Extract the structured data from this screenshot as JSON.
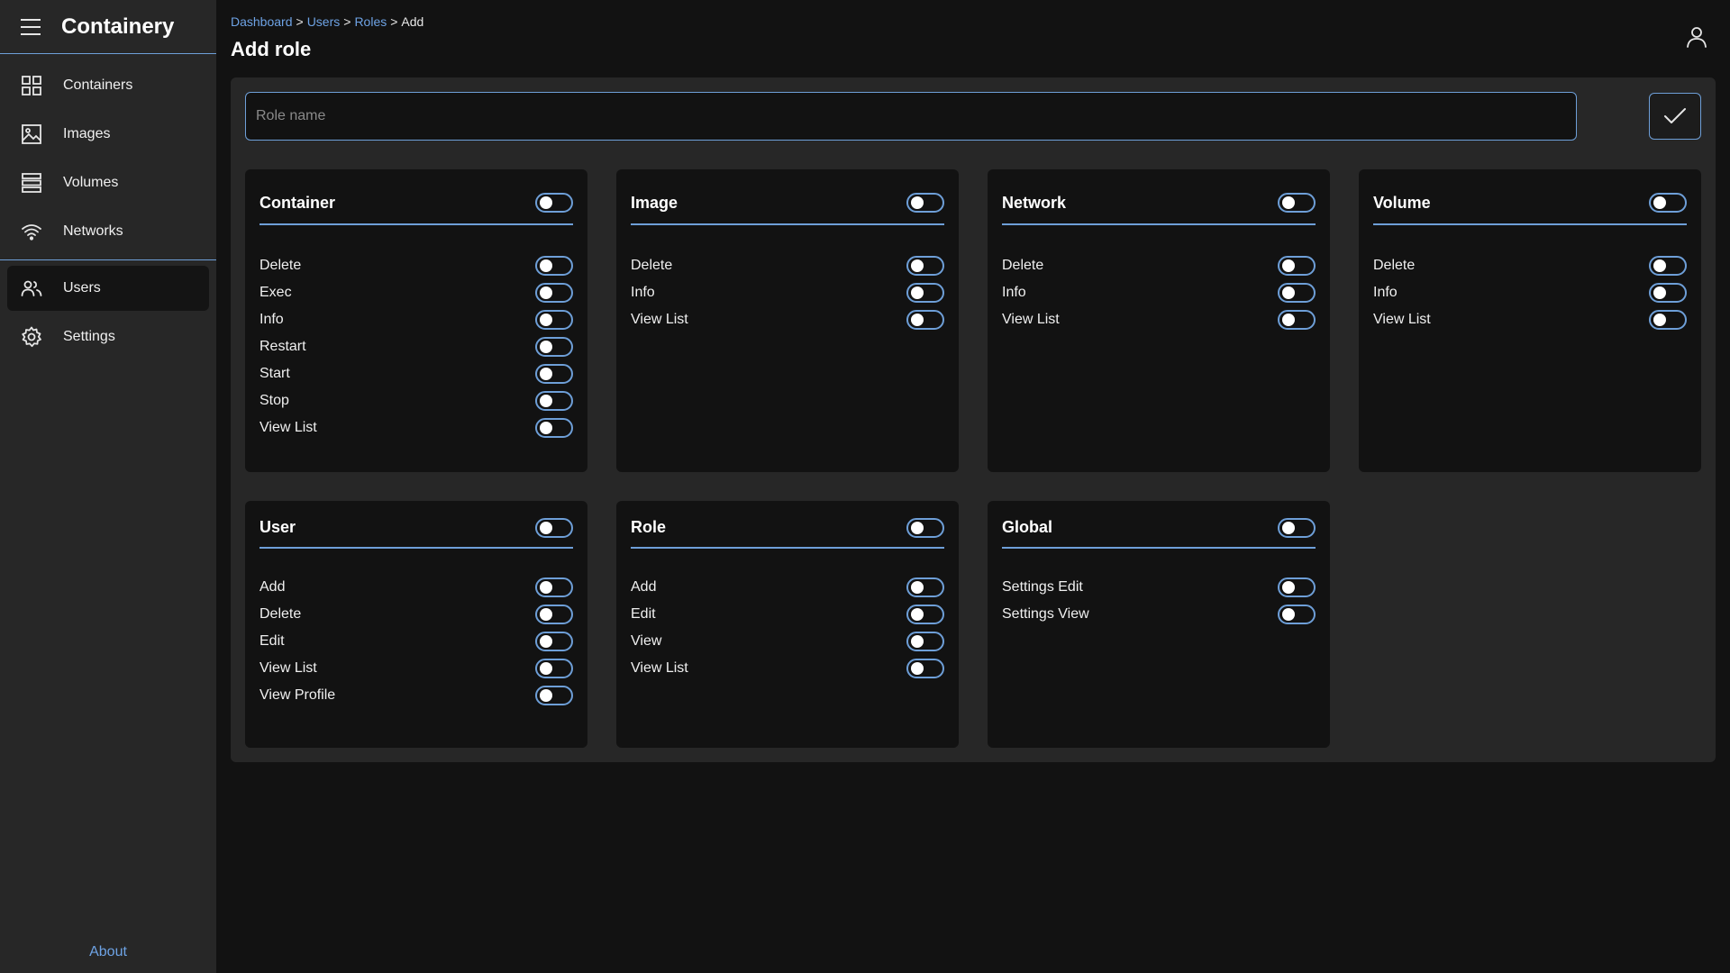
{
  "app": {
    "title": "Containery"
  },
  "sidebar": {
    "items": [
      {
        "label": "Containers",
        "icon": "grid-icon"
      },
      {
        "label": "Images",
        "icon": "image-icon"
      },
      {
        "label": "Volumes",
        "icon": "storage-icon"
      },
      {
        "label": "Networks",
        "icon": "wifi-icon"
      }
    ],
    "secondary": [
      {
        "label": "Users",
        "icon": "users-icon",
        "active": true
      },
      {
        "label": "Settings",
        "icon": "gear-icon"
      }
    ],
    "about": "About"
  },
  "breadcrumb": {
    "links": [
      "Dashboard",
      "Users",
      "Roles"
    ],
    "separator": ">",
    "current": "Add"
  },
  "page": {
    "title": "Add role"
  },
  "form": {
    "role_name_placeholder": "Role name",
    "role_name_value": ""
  },
  "colors": {
    "accent": "#6e9fd8",
    "link": "#6ea3e5",
    "sidebar_bg": "#272727",
    "page_bg": "#121212"
  },
  "cards": [
    {
      "title": "Container",
      "permissions": [
        "Delete",
        "Exec",
        "Info",
        "Restart",
        "Start",
        "Stop",
        "View List"
      ]
    },
    {
      "title": "Image",
      "permissions": [
        "Delete",
        "Info",
        "View List"
      ]
    },
    {
      "title": "Network",
      "permissions": [
        "Delete",
        "Info",
        "View List"
      ]
    },
    {
      "title": "Volume",
      "permissions": [
        "Delete",
        "Info",
        "View List"
      ]
    },
    {
      "title": "User",
      "permissions": [
        "Add",
        "Delete",
        "Edit",
        "View List",
        "View Profile"
      ]
    },
    {
      "title": "Role",
      "permissions": [
        "Add",
        "Edit",
        "View",
        "View List"
      ]
    },
    {
      "title": "Global",
      "permissions": [
        "Settings Edit",
        "Settings View"
      ]
    }
  ]
}
